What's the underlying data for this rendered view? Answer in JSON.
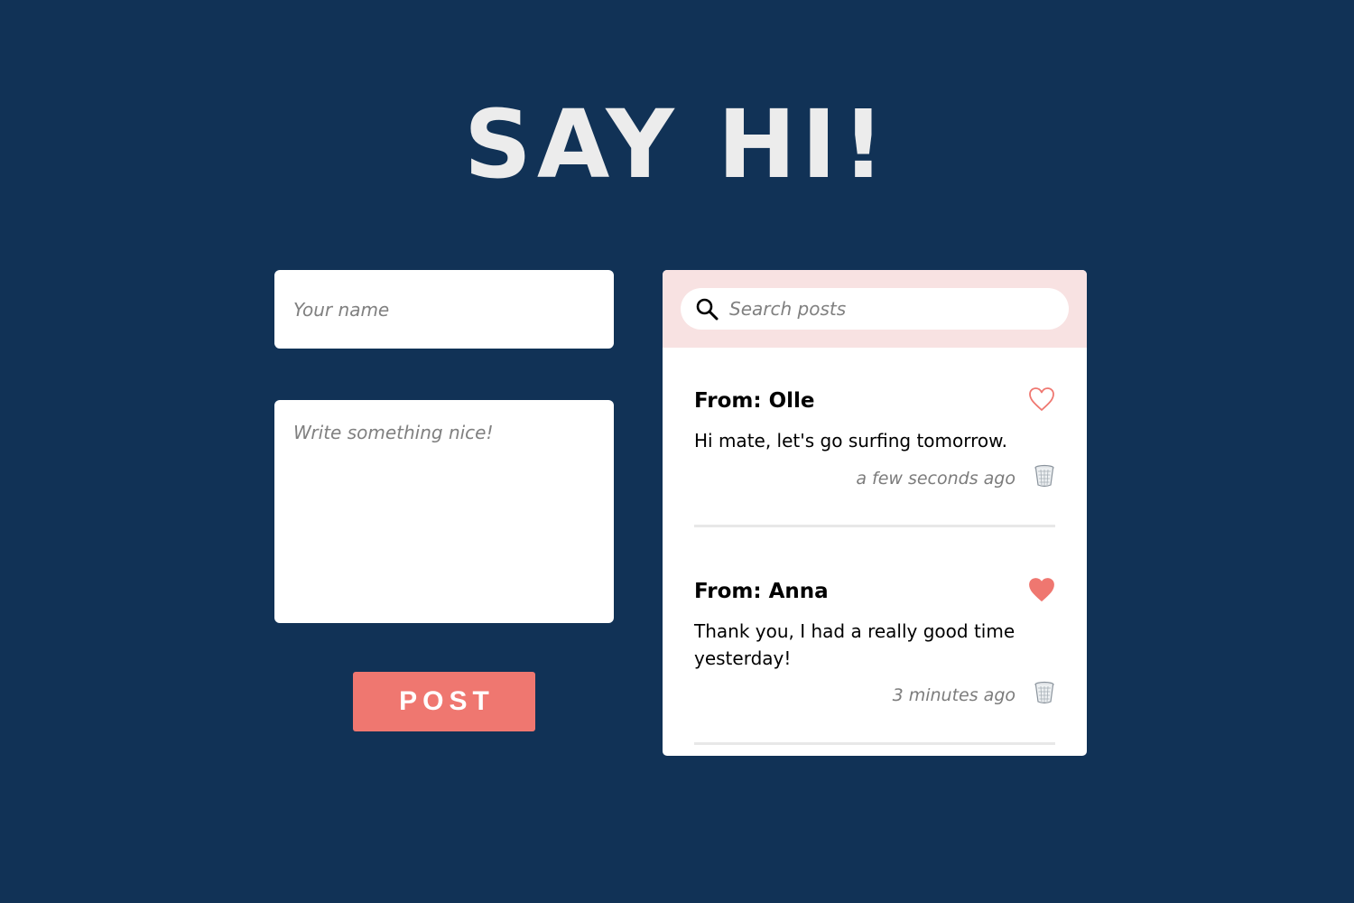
{
  "page": {
    "title": "SAY HI!"
  },
  "form": {
    "name_placeholder": "Your name",
    "message_placeholder": "Write something nice!",
    "post_label": "POST"
  },
  "search": {
    "placeholder": "Search posts"
  },
  "posts": [
    {
      "from_label": "From:",
      "author": "Olle",
      "text": "Hi mate, let's go surfing tomorrow.",
      "time": "a few seconds ago",
      "liked": false
    },
    {
      "from_label": "From:",
      "author": "Anna",
      "text": "Thank you, I had a really good time yesterday!",
      "time": "3 minutes ago",
      "liked": true
    }
  ],
  "colors": {
    "background": "#113256",
    "accent": "#ef7770",
    "search_bar": "#f8e2e2",
    "title": "#ececec"
  },
  "icons": {
    "search": "search-icon",
    "like_empty": "heart-outline-icon",
    "like_filled": "heart-filled-icon",
    "delete": "trash-icon"
  }
}
